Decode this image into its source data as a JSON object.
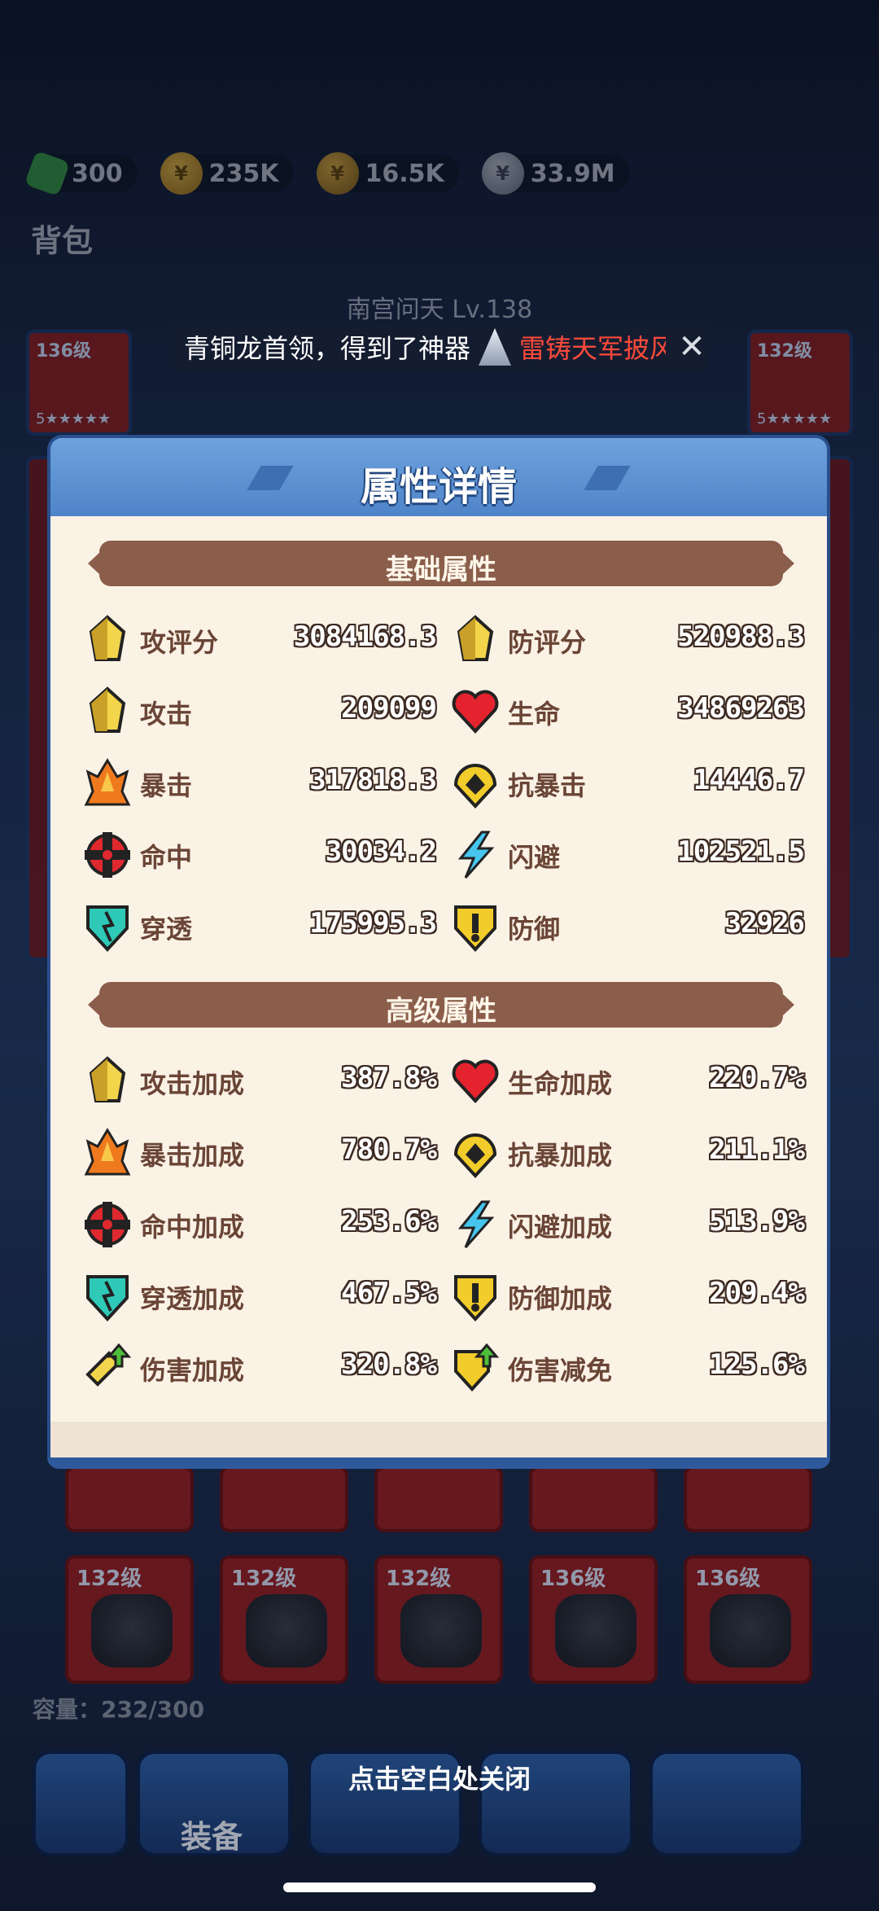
{
  "resources": [
    {
      "icon": "gem-icon",
      "value": "300"
    },
    {
      "icon": "gold-coin-icon",
      "value": "235K"
    },
    {
      "icon": "gold-coin-2-icon",
      "value": "16.5K"
    },
    {
      "icon": "silver-coin-icon",
      "value": "33.9M"
    }
  ],
  "bag_title": "背包",
  "hero_name": "南宫问天 Lv.138",
  "notice": {
    "text": "青铜龙首领，得到了神器",
    "item": "雷铸天军披风",
    "close": "✕"
  },
  "side_slots": [
    {
      "level": "136级",
      "stars": "5★★★★★"
    },
    {
      "level": "132级",
      "stars": "5★★★★★"
    }
  ],
  "modal": {
    "title": "属性详情",
    "basic_title": "基础属性",
    "advanced_title": "高级属性",
    "basic": [
      {
        "icon": "attack-score-icon",
        "label": "攻评分",
        "value": "3084168.3"
      },
      {
        "icon": "defense-score-icon",
        "label": "防评分",
        "value": "520988.3"
      },
      {
        "icon": "attack-icon",
        "label": "攻击",
        "value": "209099"
      },
      {
        "icon": "heart-icon",
        "label": "生命",
        "value": "34869263"
      },
      {
        "icon": "crit-icon",
        "label": "暴击",
        "value": "317818.3"
      },
      {
        "icon": "anti-crit-icon",
        "label": "抗暴击",
        "value": "14446.7"
      },
      {
        "icon": "hit-icon",
        "label": "命中",
        "value": "30034.2"
      },
      {
        "icon": "dodge-icon",
        "label": "闪避",
        "value": "102521.5"
      },
      {
        "icon": "penetration-icon",
        "label": "穿透",
        "value": "175995.3"
      },
      {
        "icon": "defense-icon",
        "label": "防御",
        "value": "32926"
      }
    ],
    "advanced": [
      {
        "icon": "attack-icon",
        "label": "攻击加成",
        "value": "387.8%"
      },
      {
        "icon": "heart-icon",
        "label": "生命加成",
        "value": "220.7%"
      },
      {
        "icon": "crit-icon",
        "label": "暴击加成",
        "value": "780.7%"
      },
      {
        "icon": "anti-crit-icon",
        "label": "抗暴加成",
        "value": "211.1%"
      },
      {
        "icon": "hit-icon",
        "label": "命中加成",
        "value": "253.6%"
      },
      {
        "icon": "dodge-icon",
        "label": "闪避加成",
        "value": "513.9%"
      },
      {
        "icon": "penetration-icon",
        "label": "穿透加成",
        "value": "467.5%"
      },
      {
        "icon": "defense-icon",
        "label": "防御加成",
        "value": "209.4%"
      },
      {
        "icon": "damage-bonus-icon",
        "label": "伤害加成",
        "value": "320.8%"
      },
      {
        "icon": "damage-reduce-icon",
        "label": "伤害减免",
        "value": "125.6%"
      }
    ]
  },
  "grid_items": [
    {
      "level": "132级"
    },
    {
      "level": "132级"
    },
    {
      "level": "132级"
    },
    {
      "level": "136级"
    },
    {
      "level": "136级"
    }
  ],
  "capacity": "容量：232/300",
  "nav_label": "装备",
  "close_hint": "点击空白处关闭"
}
